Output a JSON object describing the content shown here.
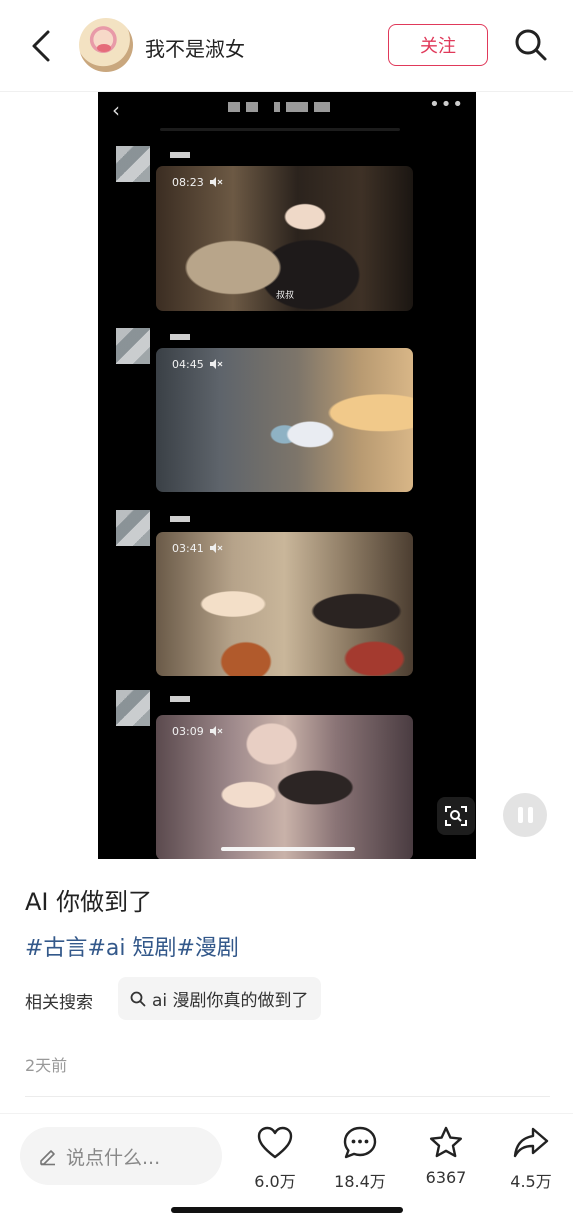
{
  "header": {
    "username": "我不是淑女",
    "follow_label": "关注"
  },
  "media": {
    "messages": [
      {
        "time": "08:23",
        "caption": "叔叔"
      },
      {
        "time": "04:45",
        "caption": ""
      },
      {
        "time": "03:41",
        "caption": ""
      },
      {
        "time": "03:09",
        "caption": ""
      }
    ],
    "playback": "paused"
  },
  "post": {
    "title": "AI 你做到了",
    "tags": [
      "#古言",
      "#ai 短剧",
      "#漫剧"
    ],
    "related_label": "相关搜索",
    "related_query": "ai 漫剧你真的做到了",
    "time_ago": "2天前"
  },
  "bottom_bar": {
    "comment_placeholder": "说点什么...",
    "likes": "6.0万",
    "comments": "18.4万",
    "favorites": "6367",
    "shares": "4.5万"
  },
  "colors": {
    "accent": "#e0395a",
    "tag": "#33588a",
    "media_bg": "#000000"
  },
  "icons": [
    "back-arrow-icon",
    "search-icon",
    "mute-icon",
    "scan-icon",
    "pause-icon",
    "pencil-icon",
    "heart-icon",
    "comment-bubble-icon",
    "star-icon",
    "share-arrow-icon"
  ]
}
